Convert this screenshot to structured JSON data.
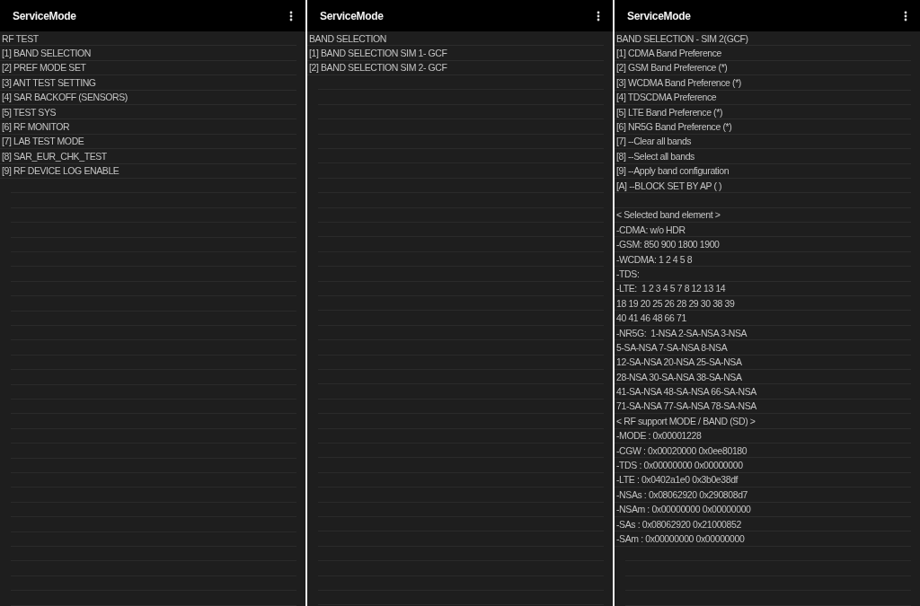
{
  "panels": [
    {
      "title": "ServiceMode",
      "sections": [
        [
          "RF TEST",
          "[1] BAND SELECTION",
          "[2] PREF MODE SET",
          "[3] ANT TEST SETTING",
          "[4] SAR BACKOFF (SENSORS)",
          "[5] TEST SYS",
          "[6] RF MONITOR",
          "[7] LAB TEST MODE",
          "[8] SAR_EUR_CHK_TEST",
          "[9] RF DEVICE LOG ENABLE"
        ]
      ]
    },
    {
      "title": "ServiceMode",
      "sections": [
        [
          "BAND SELECTION",
          "[1] BAND SELECTION SIM 1- GCF",
          "[2] BAND SELECTION SIM 2- GCF"
        ]
      ]
    },
    {
      "title": "ServiceMode",
      "sections": [
        [
          "BAND SELECTION - SIM 2(GCF)",
          "[1] CDMA Band Preference",
          "[2] GSM Band Preference (*)",
          "[3] WCDMA Band Preference (*)",
          "[4] TDSCDMA Preference",
          "[5] LTE Band Preference (*)",
          "[6] NR5G Band Preference (*)",
          "[7] --Clear all bands",
          "[8] --Select all bands",
          "[9] --Apply band configuration",
          "[A] --BLOCK SET BY AP ( )"
        ],
        [
          "< Selected band element >",
          "-CDMA: w/o HDR",
          "-GSM: 850 900 1800 1900",
          "-WCDMA: 1 2 4 5 8",
          "-TDS:",
          "-LTE:  1 2 3 4 5 7 8 12 13 14",
          "18 19 20 25 26 28 29 30 38 39",
          "40 41 46 48 66 71",
          "-NR5G:  1-NSA 2-SA-NSA 3-NSA",
          "5-SA-NSA 7-SA-NSA 8-NSA",
          "12-SA-NSA 20-NSA 25-SA-NSA",
          "28-NSA 30-SA-NSA 38-SA-NSA",
          "41-SA-NSA 48-SA-NSA 66-SA-NSA",
          "71-SA-NSA 77-SA-NSA 78-SA-NSA",
          "< RF support MODE / BAND (SD) >",
          "-MODE : 0x00001228",
          "-CGW : 0x00020000 0x0ee80180",
          "-TDS : 0x00000000 0x00000000",
          "-LTE : 0x0402a1e0 0x3b0e38df",
          "-NSAs : 0x08062920 0x290808d7",
          "-NSAm : 0x00000000 0x00000000",
          "-SAs : 0x08062920 0x21000852",
          "-SAm : 0x00000000 0x00000000"
        ]
      ]
    }
  ]
}
